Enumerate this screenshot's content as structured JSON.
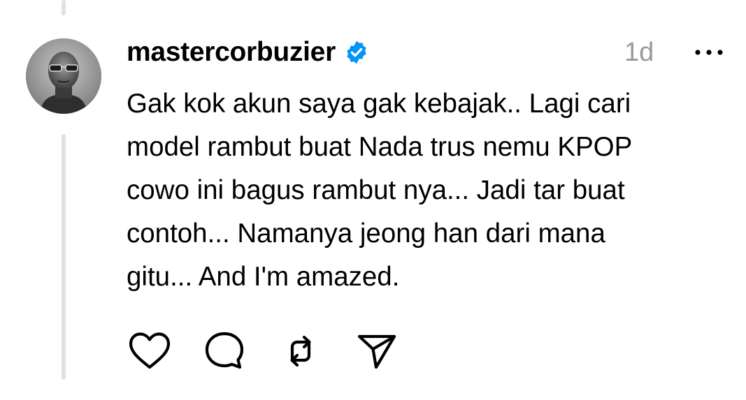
{
  "post": {
    "username": "mastercorbuzier",
    "verified": true,
    "timestamp": "1d",
    "text": "Gak kok akun saya gak kebajak.. Lagi cari\nmodel rambut buat Nada trus nemu KPOP\ncowo ini bagus rambut nya... Jadi tar buat\ncontoh... Namanya jeong han dari mana\ngitu... And I'm amazed."
  },
  "icons": {
    "verified": "verified-badge-icon",
    "more": "more-horizontal-icon",
    "like": "heart-icon",
    "reply": "comment-bubble-icon",
    "repost": "repost-icon",
    "share": "send-icon"
  },
  "colors": {
    "verified": "#0095f6",
    "thread_line": "#e1e1e1",
    "timestamp": "#999999"
  }
}
